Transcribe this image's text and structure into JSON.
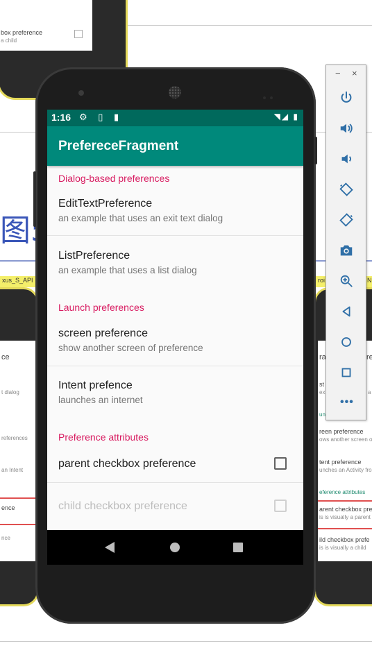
{
  "background": {
    "top_snippet": {
      "title": "box preference",
      "sub": "a child"
    },
    "heading": "图5",
    "left_tab": "xus_S_API",
    "right_tab_a": "roi",
    "right_tab_b": "N",
    "left_phone": {
      "title": "ce",
      "items": [
        "t dialog",
        "references",
        "an Intent",
        "ence",
        "nce"
      ]
    },
    "right_phone": {
      "title": "rag",
      "title_b": "re",
      "items": [
        {
          "title": "st p",
          "sub": "ex",
          "sub_b": "a"
        },
        {
          "title": "unc",
          "sub": "",
          "green": true
        },
        {
          "title": "reen preference",
          "sub": "ows another screen o"
        },
        {
          "title": "tent preference",
          "sub": "unches an Activity fro"
        },
        {
          "title": "eference attributes",
          "sub": "",
          "green": true
        },
        {
          "title": "arent checkbox pref",
          "sub": "is is visually a parent"
        },
        {
          "title": "ild checkbox prefe",
          "sub": "is is visually a child"
        }
      ]
    }
  },
  "phone": {
    "status": {
      "time": "1:16",
      "left_icons": "⚙ ▯ ▮",
      "right_icons": "◥◢ ▮"
    },
    "app_title": "PrefereceFragment",
    "categories": {
      "dialog": "Dialog-based preferences",
      "launch": "Launch preferences",
      "attributes": "Preference attributes"
    },
    "prefs": {
      "edittext": {
        "title": "EditTextPreference",
        "summary": "an example that uses an exit text dialog"
      },
      "list": {
        "title": "ListPreference",
        "summary": "an example that uses a list dialog"
      },
      "screen": {
        "title": "screen preference",
        "summary": "show another screen of preference"
      },
      "intent": {
        "title": "Intent prefence",
        "summary": "launches an internet"
      },
      "parent_checkbox": {
        "title": "parent checkbox preference",
        "checked": false
      },
      "child_checkbox": {
        "title": "child checkbox preference",
        "checked": false,
        "enabled": false
      }
    }
  },
  "toolbar": {
    "minimize": "−",
    "close": "×",
    "buttons": [
      "power-icon",
      "volume-up-icon",
      "volume-down-icon",
      "rotate-left-icon",
      "rotate-right-icon",
      "camera-icon",
      "zoom-icon",
      "back-icon",
      "home-icon",
      "overview-icon"
    ],
    "more": "•••",
    "accent": "#2f6fa7"
  }
}
